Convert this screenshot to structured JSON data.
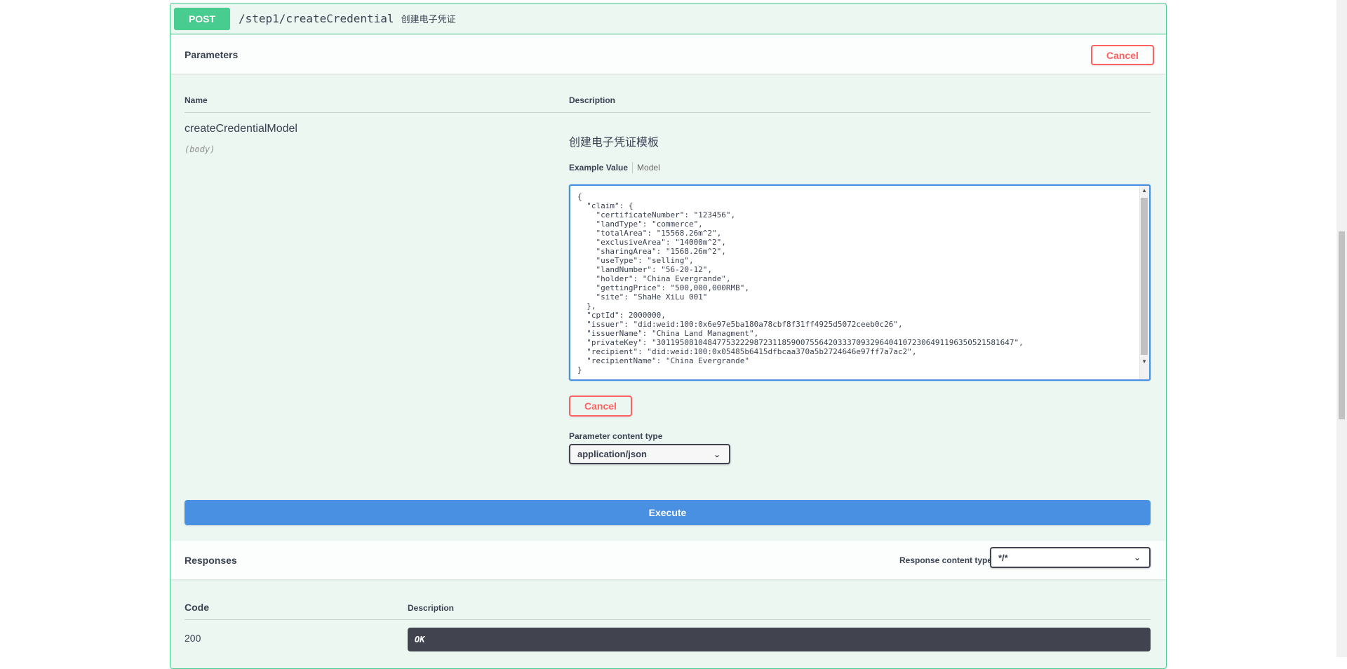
{
  "operation": {
    "method": "POST",
    "path": "/step1/createCredential",
    "summary": "创建电子凭证"
  },
  "parameters": {
    "title": "Parameters",
    "cancel_label": "Cancel",
    "col_name": "Name",
    "col_description": "Description",
    "param": {
      "name": "createCredentialModel",
      "in": "(body)",
      "description": "创建电子凭证模板"
    },
    "tabs": {
      "example_value": "Example Value",
      "model": "Model"
    },
    "body_text": "{\n  \"claim\": {\n    \"certificateNumber\": \"123456\",\n    \"landType\": \"commerce\",\n    \"totalArea\": \"15568.26m^2\",\n    \"exclusiveArea\": \"14000m^2\",\n    \"sharingArea\": \"1568.26m^2\",\n    \"useType\": \"selling\",\n    \"landNumber\": \"56-20-12\",\n    \"holder\": \"China Evergrande\",\n    \"gettingPrice\": \"500,000,000RMB\",\n    \"site\": \"ShaHe XiLu 001\"\n  },\n  \"cptId\": 2000000,\n  \"issuer\": \"did:weid:100:0x6e97e5ba180a78cbf8f31ff4925d5072ceeb0c26\",\n  \"issuerName\": \"China Land Managment\",\n  \"privateKey\": \"30119508104847753222987231185900755642033370932964041072306491196350521581647\",\n  \"recipient\": \"did:weid:100:0x05485b6415dfbcaa370a5b2724646e97ff7a7ac2\",\n  \"recipientName\": \"China Evergrande\"\n}",
    "inner_cancel_label": "Cancel",
    "content_type_label": "Parameter content type",
    "content_type_value": "application/json"
  },
  "execute_label": "Execute",
  "responses": {
    "title": "Responses",
    "content_type_label": "Response content type",
    "content_type_value": "*/*",
    "col_code": "Code",
    "col_description": "Description",
    "rows": [
      {
        "code": "200",
        "description": "OK"
      }
    ]
  },
  "colors": {
    "post_green": "#49cc90",
    "execute_blue": "#4990e2",
    "cancel_red": "#ff6060",
    "dark": "#41444e"
  },
  "icons": {
    "select_chevron": "chevron-down-icon"
  }
}
